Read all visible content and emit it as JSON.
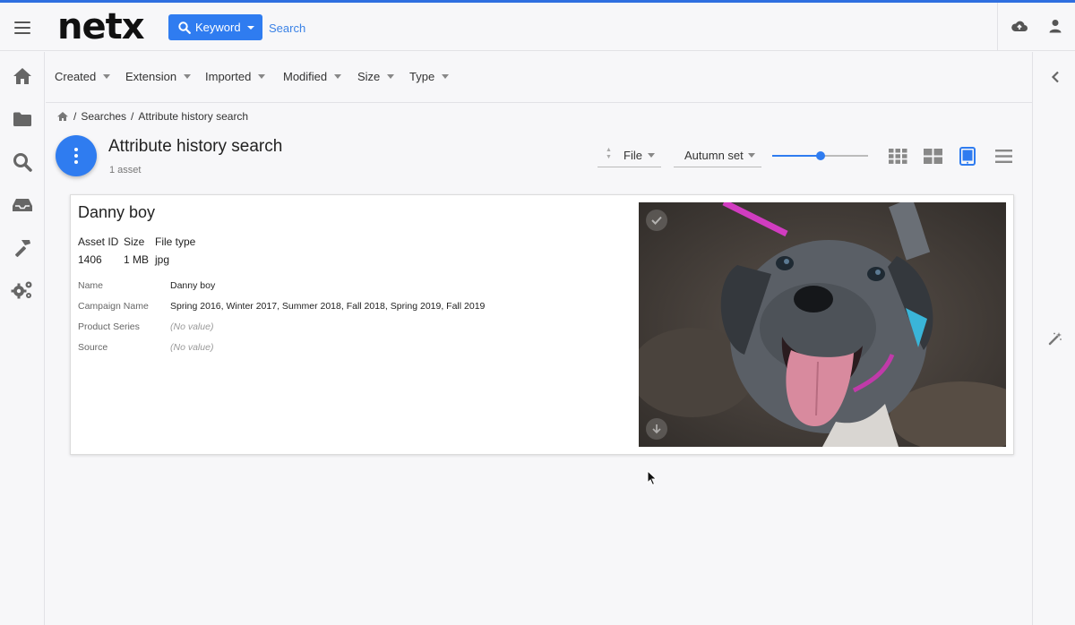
{
  "app": {
    "logo_text": "netx",
    "accent": "#2f7cf0"
  },
  "search": {
    "mode_label": "Keyword",
    "placeholder": "Search"
  },
  "header_icons": [
    "upload-cloud-icon",
    "user-icon"
  ],
  "left_nav": [
    "home-icon",
    "folder-icon",
    "search-icon",
    "inbox-icon",
    "hammer-icon",
    "gears-icon"
  ],
  "right_panel": [
    "chevron-left-icon",
    "magic-wand-icon"
  ],
  "filters": [
    "Created",
    "Extension",
    "Imported",
    "Modified",
    "Size",
    "Type"
  ],
  "breadcrumb": {
    "sep": "/",
    "items": [
      "Searches",
      "Attribute history search"
    ]
  },
  "page": {
    "title": "Attribute history search",
    "count": "1 asset"
  },
  "toolbar": {
    "sort_label": "File",
    "set_label": "Autumn set",
    "zoom_fraction": 0.5,
    "views": [
      "grid-small-icon",
      "grid-large-icon",
      "tablet-view-icon",
      "list-view-icon"
    ],
    "active_view": "tablet-view-icon"
  },
  "asset": {
    "title": "Danny boy",
    "headers": {
      "id": "Asset ID",
      "size": "Size",
      "type": "File type"
    },
    "values": {
      "id": "1406",
      "size": "1 MB",
      "type": "jpg"
    },
    "attributes": [
      {
        "label": "Name",
        "value": "Danny boy"
      },
      {
        "label": "Campaign Name",
        "value": "Spring 2016, Winter 2017, Summer 2018, Fall 2018, Spring 2019, Fall 2019"
      },
      {
        "label": "Product Series",
        "value": "(No value)"
      },
      {
        "label": "Source",
        "value": "(No value)"
      }
    ]
  }
}
